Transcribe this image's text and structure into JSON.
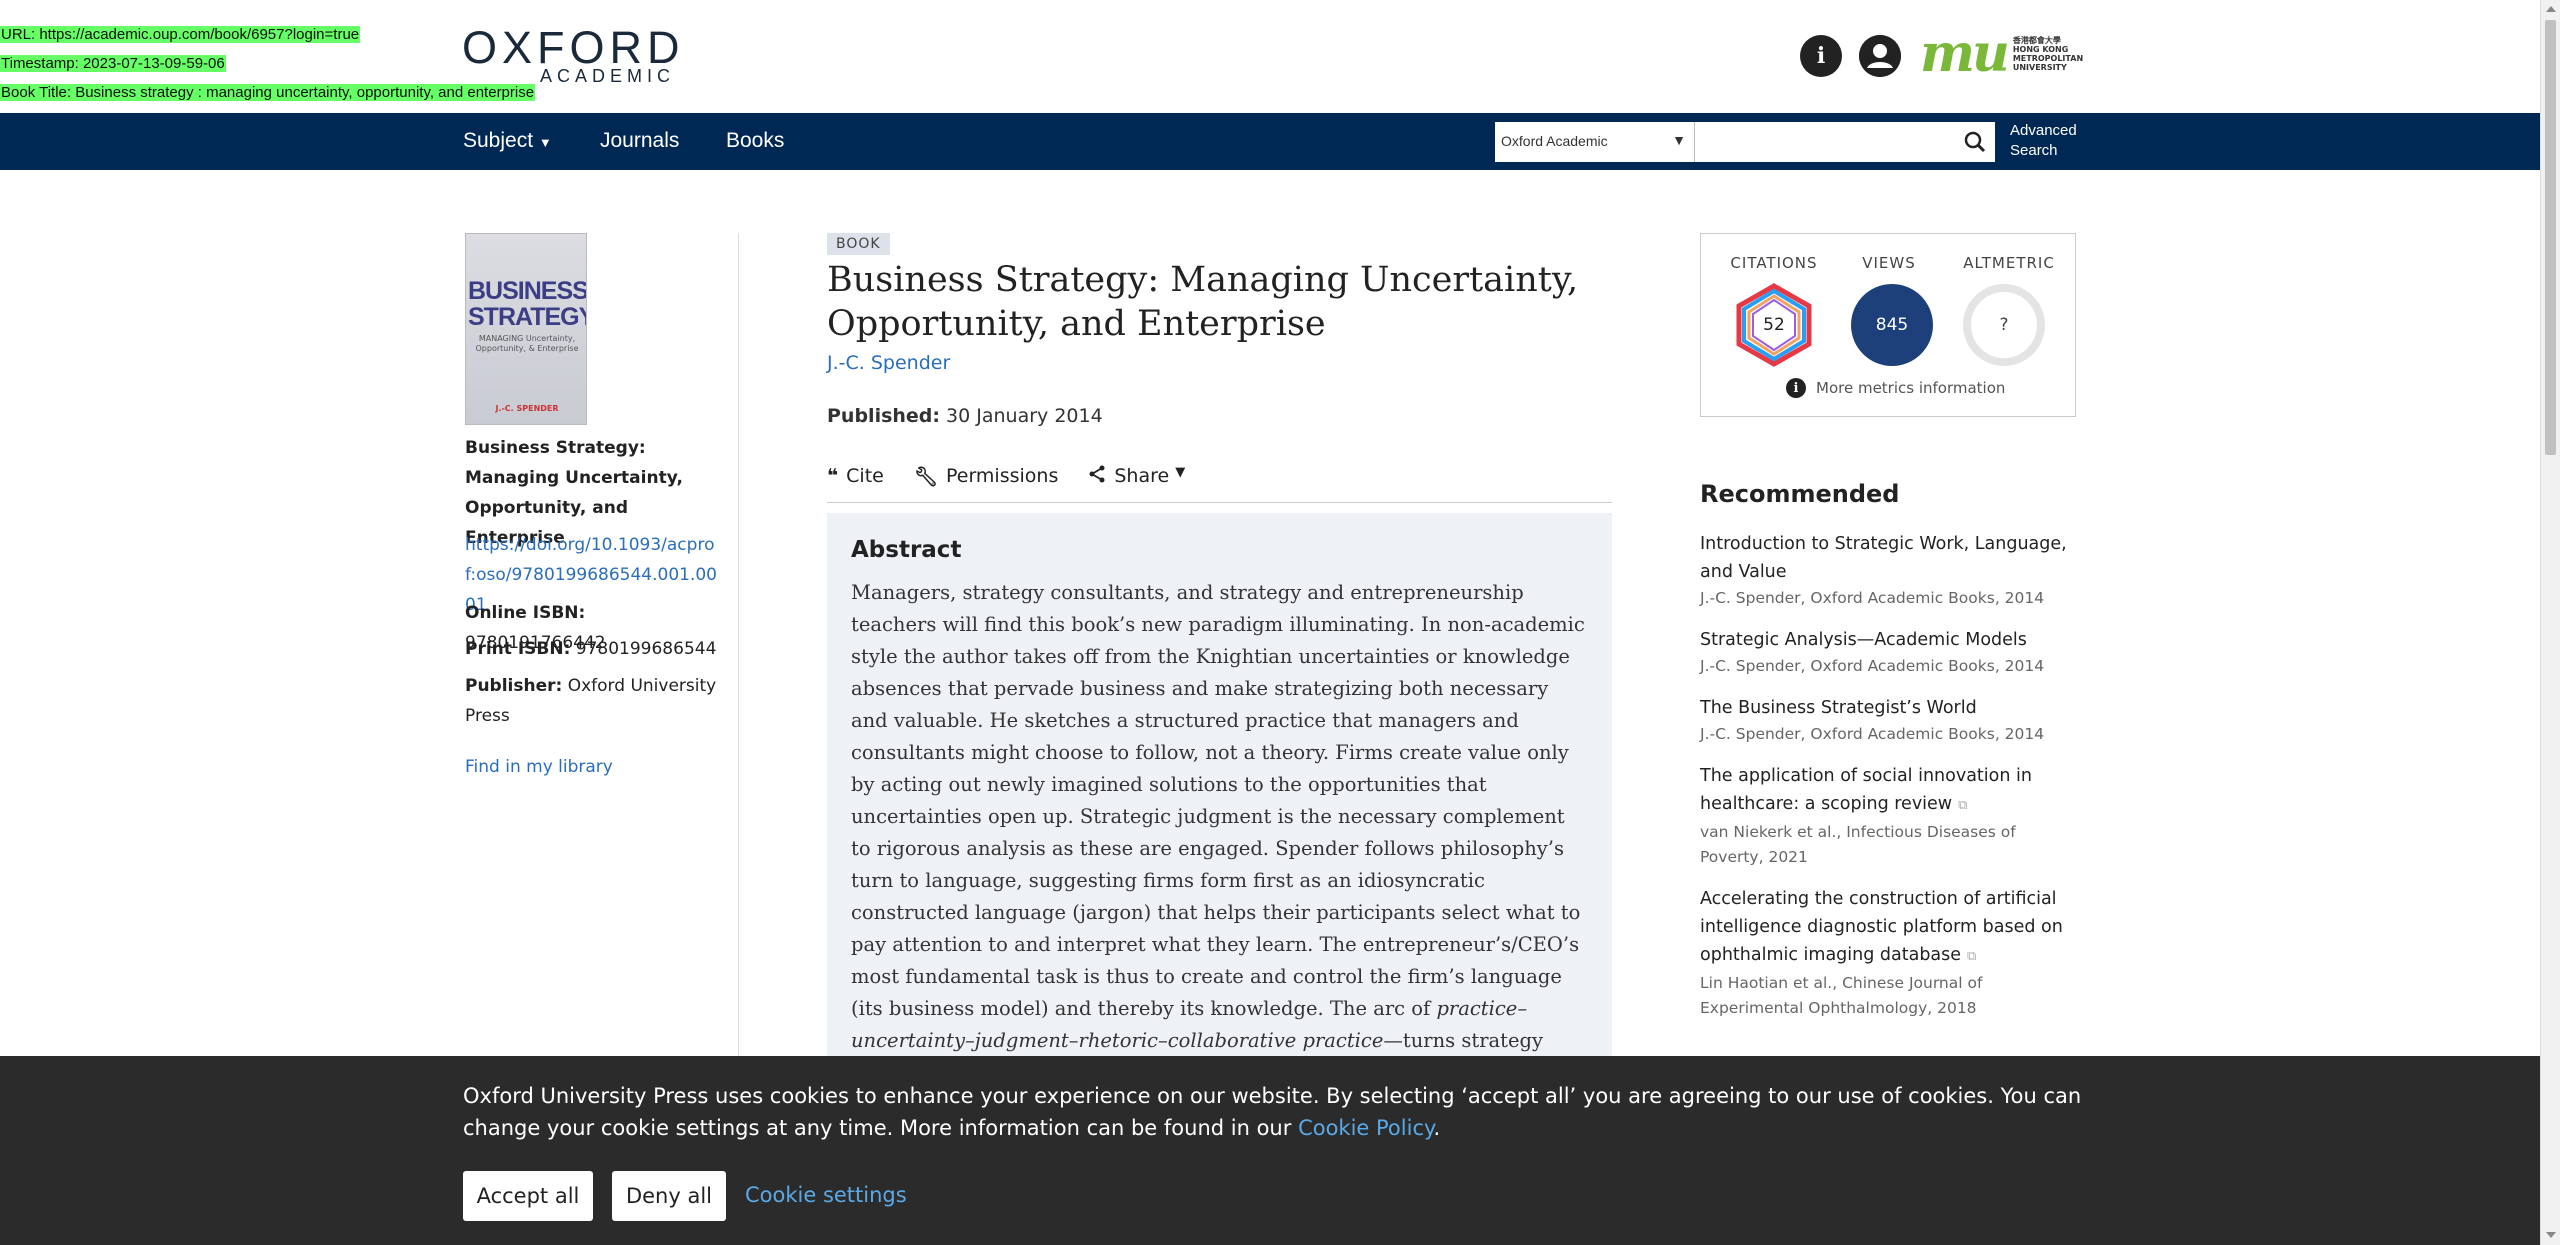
{
  "overlay": {
    "url": "URL: https://academic.oup.com/book/6957?login=true",
    "timestamp": "Timestamp: 2023-07-13-09-59-06",
    "book_title": "Book Title: Business strategy : managing uncertainty, opportunity, and enterprise"
  },
  "header": {
    "logo_main": "OXFORD",
    "logo_sub": "ACADEMIC",
    "institution_logo": "mu",
    "institution_text": [
      "香港都會大學",
      "HONG KONG",
      "METROPOLITAN",
      "UNIVERSITY"
    ]
  },
  "nav": {
    "items": [
      "Subject",
      "Journals",
      "Books"
    ],
    "search_scope": "Oxford Academic",
    "search_placeholder": "",
    "advanced_search_1": "Advanced",
    "advanced_search_2": "Search"
  },
  "sidebar": {
    "cover_title": "BUSINESS STRATEGY",
    "cover_subtitle": "MANAGING Uncertainty, Opportunity, & Enterprise",
    "cover_author": "J.-C. SPENDER",
    "book_title": "Business Strategy: Managing Uncertainty, Opportunity, and Enterprise",
    "doi": "https://doi.org/10.1093/acprof:oso/9780199686544.001.0001",
    "online_isbn_label": "Online ISBN:",
    "online_isbn": "9780191766442",
    "print_isbn_label": "Print ISBN:",
    "print_isbn": "9780199686544",
    "publisher_label": "Publisher:",
    "publisher": "Oxford University Press",
    "find_library": "Find in my library"
  },
  "main": {
    "badge": "BOOK",
    "title": "Business Strategy: Managing Uncertainty, Opportunity, and Enterprise",
    "author": "J.-C. Spender",
    "published_label": "Published:",
    "published_date": "30 January 2014",
    "tools": [
      "Cite",
      "Permissions",
      "Share"
    ],
    "abstract_heading": "Abstract",
    "abstract_text_1": "Managers, strategy consultants, and strategy and entrepreneurship teachers will find this book’s new paradigm illuminating. In non-academic style the author takes off from the Knightian uncertainties or knowledge absences that pervade business and make strategizing both necessary and valuable. He sketches a structured practice that managers and consultants might choose to follow, not a theory. Firms create value only by acting out newly imagined solutions to the opportunities that uncertainties open up. Strategic judgment is the necessary complement to rigorous analysis as these are engaged. Spender follows philosophy’s turn to language, suggesting firms form first as an idiosyncratic constructed language (jargon) that helps their participants select what to pay attention to and interpret what they learn. The entrepreneur’s/CEO’s most fundamental task is thus to create and control the firm’s language (its business model) and thereby its knowledge. The arc of ",
    "abstract_italic": "practice–uncertainty–judgment–rhetoric–collaborative practice",
    "abstract_text_2": "—turns strategy discourse on its head, presenting it as a constructive value-creating activity"
  },
  "metrics": {
    "citations_label": "CITATIONS",
    "citations": "52",
    "views_label": "VIEWS",
    "views": "845",
    "altmetric_label": "ALTMETRIC",
    "altmetric": "?",
    "more_info": "More metrics information"
  },
  "recommended": {
    "heading": "Recommended",
    "items": [
      {
        "title": "Introduction to Strategic Work, Language, and Value",
        "source": "J.-C. Spender, Oxford Academic Books, 2014"
      },
      {
        "title": "Strategic Analysis—Academic Models",
        "source": "J.-C. Spender, Oxford Academic Books, 2014"
      },
      {
        "title": "The Business Strategist’s World",
        "source": "J.-C. Spender, Oxford Academic Books, 2014"
      },
      {
        "title": "The application of social innovation in healthcare: a scoping review",
        "source": "van Niekerk et al., Infectious Diseases of Poverty, 2021"
      },
      {
        "title": "Accelerating the construction of artificial intelligence diagnostic platform based on ophthalmic imaging database",
        "source": "Lin Haotian et al., Chinese Journal of Experimental Ophthalmology, 2018"
      }
    ]
  },
  "cookie": {
    "text": "Oxford University Press uses cookies to enhance your experience on our website. By selecting ‘accept all’ you are agreeing to our use of cookies. You can change your cookie settings at any time. More information can be found in our ",
    "policy_link": "Cookie Policy",
    "period": ".",
    "accept": "Accept all",
    "deny": "Deny all",
    "settings": "Cookie settings"
  },
  "colors": {
    "nav_bg": "#002855",
    "link": "#2a6ebb",
    "views_circle": "#1d3f7a",
    "cookie_bg": "#2b2b2b",
    "overlay_highlight": "#66ff66"
  }
}
